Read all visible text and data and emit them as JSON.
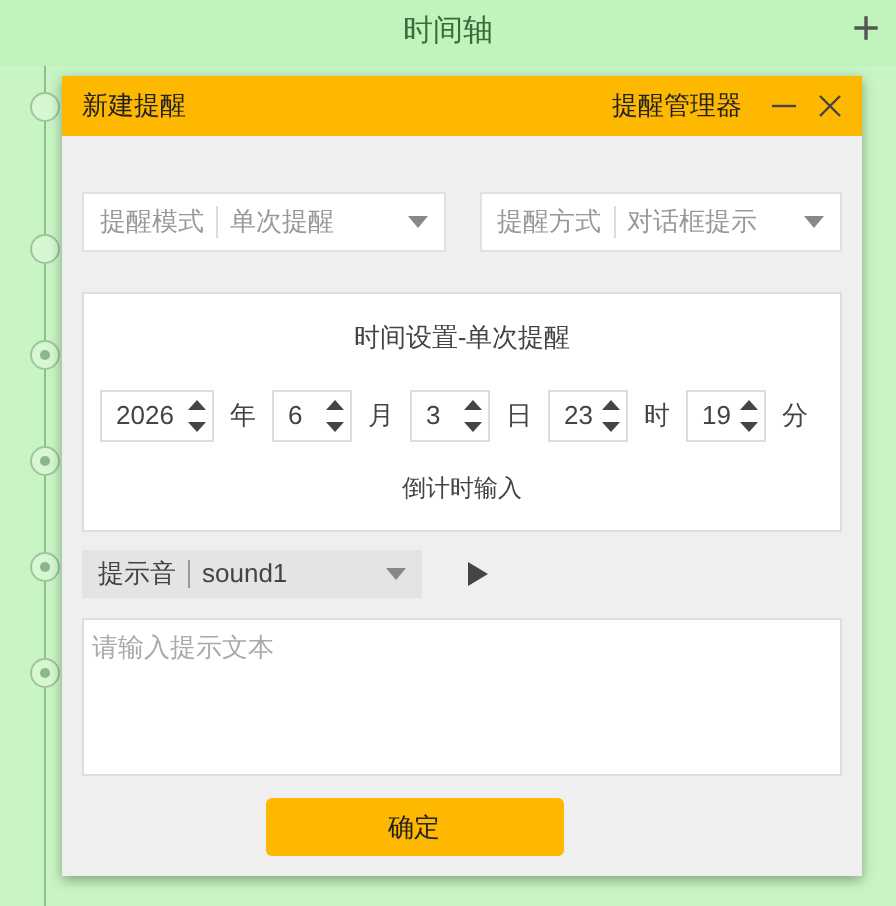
{
  "header": {
    "title": "时间轴",
    "add_button": "+"
  },
  "timeline": {
    "nodes": [
      {
        "kind": "hollow"
      },
      {
        "kind": "hollow"
      },
      {
        "kind": "dotted"
      },
      {
        "kind": "dotted"
      },
      {
        "kind": "dotted"
      },
      {
        "kind": "dotted"
      }
    ]
  },
  "dialog": {
    "title": "新建提醒",
    "manager_link": "提醒管理器",
    "selects": [
      {
        "label": "提醒模式",
        "value": "单次提醒"
      },
      {
        "label": "提醒方式",
        "value": "对话框提示"
      }
    ],
    "time_panel": {
      "title": "时间设置-单次提醒",
      "fields": [
        {
          "value": "2026",
          "unit": "年"
        },
        {
          "value": "6",
          "unit": "月"
        },
        {
          "value": "3",
          "unit": "日"
        },
        {
          "value": "23",
          "unit": "时"
        },
        {
          "value": "19",
          "unit": "分"
        }
      ],
      "countdown_link": "倒计时输入"
    },
    "sound": {
      "label": "提示音",
      "value": "sound1"
    },
    "message": {
      "placeholder": "请输入提示文本"
    },
    "confirm_button": "确定"
  }
}
